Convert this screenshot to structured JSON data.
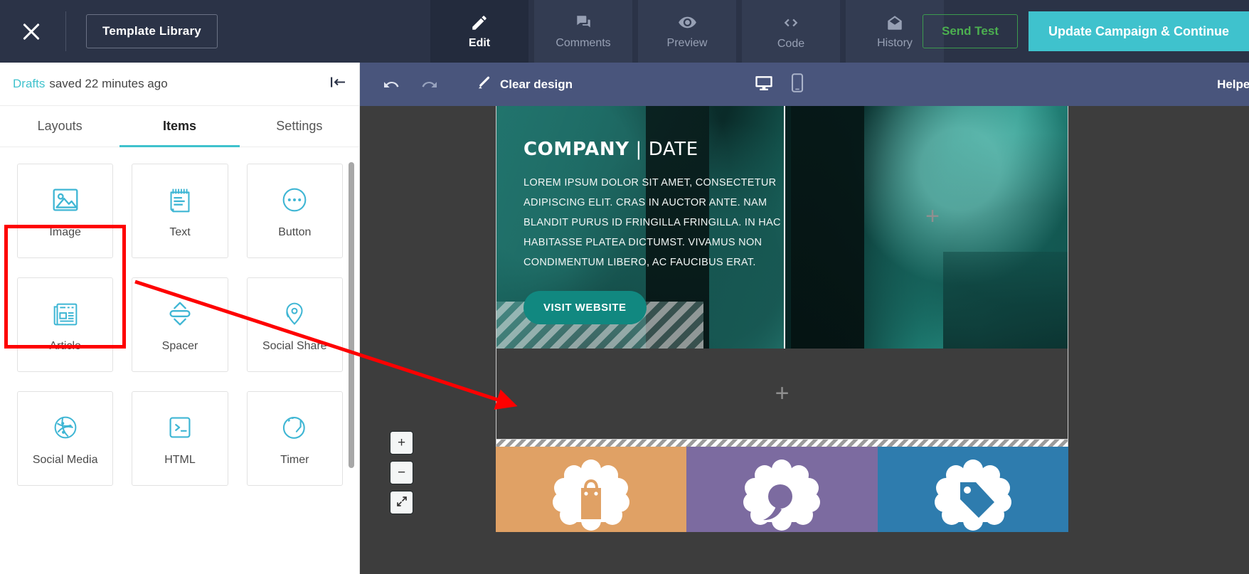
{
  "topbar": {
    "close_label": "close-icon",
    "template_library": "Template Library",
    "tabs": [
      {
        "label": "Edit",
        "icon": "pencil-icon",
        "active": true
      },
      {
        "label": "Comments",
        "icon": "comments-icon",
        "active": false
      },
      {
        "label": "Preview",
        "icon": "eye-icon",
        "active": false
      },
      {
        "label": "Code",
        "icon": "code-icon",
        "active": false
      },
      {
        "label": "History",
        "icon": "envelope-icon",
        "active": false
      }
    ],
    "send_test": "Send Test",
    "update_campaign": "Update Campaign & Continue",
    "background": "#2b3347",
    "accent": "#3fc2cd",
    "send_test_color": "#4caf50"
  },
  "sidebar": {
    "draft_link": "Drafts",
    "draft_status": "saved 22 minutes ago",
    "collapse_icon": "collapse-panel-icon",
    "tabs": [
      {
        "label": "Layouts",
        "active": false
      },
      {
        "label": "Items",
        "active": true
      },
      {
        "label": "Settings",
        "active": false
      }
    ],
    "items": [
      {
        "label": "Image",
        "icon": "image-icon"
      },
      {
        "label": "Text",
        "icon": "text-notepad-icon"
      },
      {
        "label": "Button",
        "icon": "button-ellipsis-icon"
      },
      {
        "label": "Article",
        "icon": "article-newspaper-icon"
      },
      {
        "label": "Spacer",
        "icon": "spacer-arrows-icon"
      },
      {
        "label": "Social Share",
        "icon": "social-share-pin-icon"
      },
      {
        "label": "Social Media",
        "icon": "social-media-globe-icon"
      },
      {
        "label": "HTML",
        "icon": "html-terminal-icon"
      },
      {
        "label": "Timer",
        "icon": "timer-gauge-icon"
      }
    ],
    "highlight_color": "#fe0000",
    "icon_color": "#3fb6d4"
  },
  "canvas_toolbar": {
    "undo": "undo-icon",
    "redo": "redo-icon",
    "clear_design": "Clear design",
    "desktop_view": "desktop-icon",
    "mobile_view": "mobile-icon",
    "helper": "Helper",
    "background": "#49557c"
  },
  "zoom_controls": {
    "zoom_in": "+",
    "zoom_out": "−",
    "fit": "fit-screen-icon"
  },
  "email": {
    "hero": {
      "title_bold": "COMPANY",
      "title_sep": " | ",
      "title_light": "DATE",
      "paragraph_lines": [
        "LOREM IPSUM DOLOR SIT AMET, CONSECTETUR",
        "ADIPISCING ELIT. CRAS IN AUCTOR ANTE. NAM",
        "BLANDIT PURUS ID FRINGILLA FRINGILLA. IN HAC",
        "HABITASSE PLATEA DICTUMST. VIVAMUS NON",
        "CONDIMENTUM LIBERO, AC FAUCIBUS ERAT."
      ],
      "cta": "VISIT WEBSITE",
      "cta_color": "#118880",
      "add_marker": "+"
    },
    "empty_row": {
      "add_marker": "+"
    },
    "tiles": [
      {
        "icon": "shopping-bag-badge-icon",
        "color": "#e0a165"
      },
      {
        "icon": "speech-bubble-badge-icon",
        "color": "#7c6ba0"
      },
      {
        "icon": "price-tag-badge-icon",
        "color": "#2e7cae"
      }
    ]
  }
}
